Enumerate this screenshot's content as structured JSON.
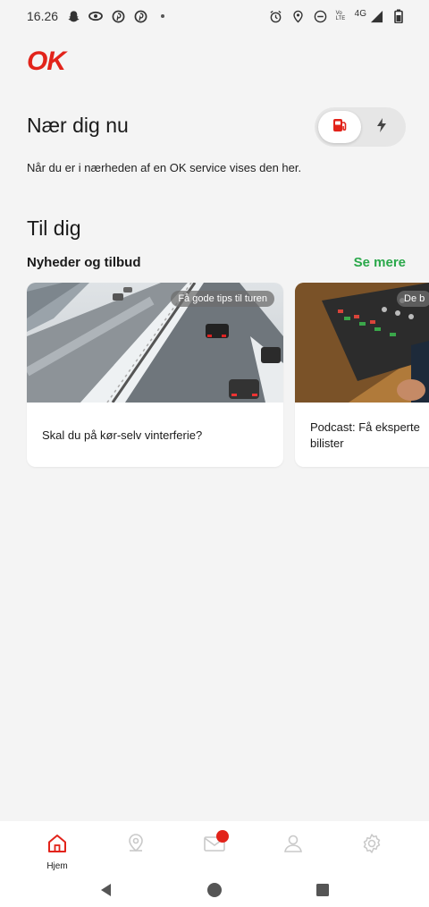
{
  "status_bar": {
    "time": "16.26",
    "left_icons": [
      "snapchat-icon",
      "eye-icon",
      "pinterest-icon",
      "pinterest-icon",
      "dot-icon"
    ],
    "right_icons": [
      "alarm-icon",
      "location-icon",
      "do-not-disturb-icon",
      "volte-icon",
      "signal-icon",
      "battery-icon"
    ],
    "network": "4G",
    "volte_text": "Vo LTE"
  },
  "app": {
    "logo": "OK",
    "brand_color": "#e2231a",
    "accent_color": "#2aa84a"
  },
  "near": {
    "title": "Nær dig nu",
    "description": "Når du er i nærheden af en OK service vises den her.",
    "toggle": {
      "selected": "fuel",
      "options": [
        "fuel-pump-icon",
        "lightning-icon"
      ]
    }
  },
  "for_you": {
    "title": "Til dig",
    "news": {
      "heading": "Nyheder og tilbud",
      "see_more": "Se mere",
      "cards": [
        {
          "tag": "Få gode tips til turen",
          "title": "Skal du på kør-selv vinterferie?",
          "image": "snowy-highway"
        },
        {
          "tag": "De b",
          "title": "Podcast: Få eksperte",
          "title_line2": "bilister",
          "image": "mixing-console"
        }
      ]
    }
  },
  "bottom_nav": {
    "items": [
      {
        "label": "Hjem",
        "icon": "home-icon",
        "active": true
      },
      {
        "label": "",
        "icon": "map-pin-icon"
      },
      {
        "label": "",
        "icon": "mail-icon",
        "badge": true
      },
      {
        "label": "",
        "icon": "user-icon"
      },
      {
        "label": "",
        "icon": "gear-icon"
      }
    ]
  },
  "system_nav": [
    "back-icon",
    "home-circle-icon",
    "recents-icon"
  ]
}
